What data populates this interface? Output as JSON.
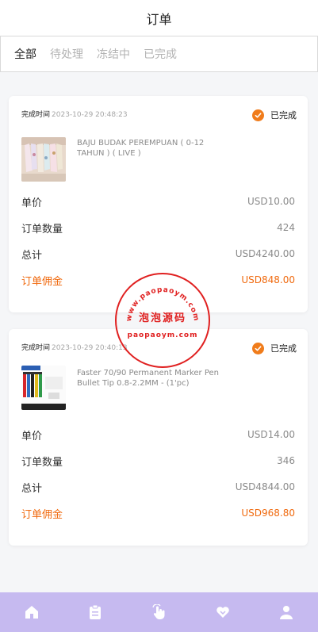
{
  "header": {
    "title": "订单"
  },
  "tabs": [
    {
      "label": "全部",
      "active": true
    },
    {
      "label": "待处理",
      "active": false
    },
    {
      "label": "冻结中",
      "active": false
    },
    {
      "label": "已完成",
      "active": false
    }
  ],
  "orders": [
    {
      "time_label": "完成时间",
      "time": "2023-10-29 20:48:23",
      "status": "已完成",
      "product": "BAJU BUDAK PEREMPUAN ( 0-12 TAHUN ) ( LIVE )",
      "rows": [
        {
          "label": "单价",
          "value": "USD10.00"
        },
        {
          "label": "订单数量",
          "value": "424"
        },
        {
          "label": "总计",
          "value": "USD4240.00"
        },
        {
          "label": "订单佣金",
          "value": "USD848.00"
        }
      ]
    },
    {
      "time_label": "完成时间",
      "time": "2023-10-29 20:40:13",
      "status": "已完成",
      "product": "Faster 70/90 Permanent Marker Pen Bullet Tip 0.8-2.2MM - (1'pc)",
      "rows": [
        {
          "label": "单价",
          "value": "USD14.00"
        },
        {
          "label": "订单数量",
          "value": "346"
        },
        {
          "label": "总计",
          "value": "USD4844.00"
        },
        {
          "label": "订单佣金",
          "value": "USD968.80"
        }
      ]
    }
  ],
  "watermark": {
    "top_text": "www.paopaoym.com",
    "center_text": "泡泡源码",
    "bottom_text": "paopaoym.com"
  },
  "bottom_nav": [
    {
      "icon": "home-icon"
    },
    {
      "icon": "clipboard-icon"
    },
    {
      "icon": "tap-hand-icon"
    },
    {
      "icon": "heart-icon"
    },
    {
      "icon": "user-icon"
    }
  ],
  "colors": {
    "accent": "#f06a0f",
    "nav_bg": "#c6baf0",
    "status_check": "#f07c1b"
  }
}
